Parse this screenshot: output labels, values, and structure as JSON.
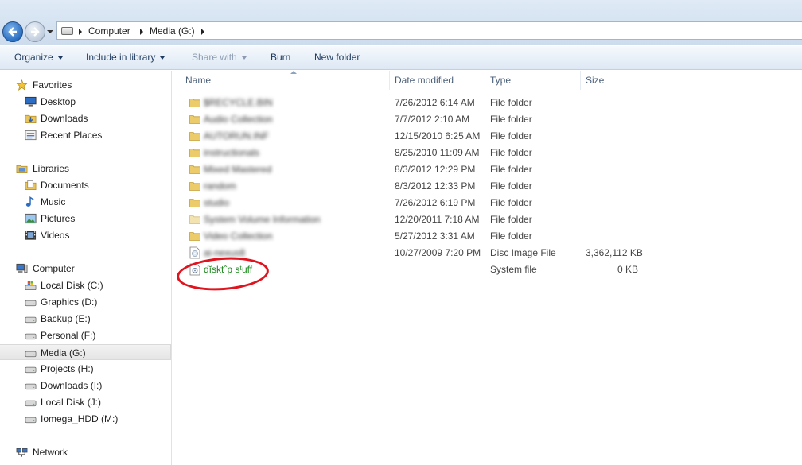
{
  "address": {
    "crumbs": [
      "Computer",
      "Media (G:)"
    ]
  },
  "toolbar": {
    "organize": "Organize",
    "include": "Include in library",
    "share": "Share with",
    "burn": "Burn",
    "newfolder": "New folder"
  },
  "sidebar": {
    "favorites": "Favorites",
    "fav_items": [
      "Desktop",
      "Downloads",
      "Recent Places"
    ],
    "libraries": "Libraries",
    "lib_items": [
      "Documents",
      "Music",
      "Pictures",
      "Videos"
    ],
    "computer": "Computer",
    "drives": [
      "Local Disk (C:)",
      "Graphics (D:)",
      "Backup (E:)",
      "Personal (F:)",
      "Media (G:)",
      "Projects (H:)",
      "Downloads (I:)",
      "Local Disk (J:)",
      "Iomega_HDD (M:)"
    ],
    "network": "Network"
  },
  "columns": {
    "name": "Name",
    "date": "Date modified",
    "type": "Type",
    "size": "Size"
  },
  "files": [
    {
      "name": "$RECYCLE.BIN",
      "date": "7/26/2012 6:14 AM",
      "type": "File folder",
      "size": ""
    },
    {
      "name": "Audio Collection",
      "date": "7/7/2012 2:10 AM",
      "type": "File folder",
      "size": ""
    },
    {
      "name": "AUTORUN.INF",
      "date": "12/15/2010 6:25 AM",
      "type": "File folder",
      "size": ""
    },
    {
      "name": "instructionals",
      "date": "8/25/2010 11:09 AM",
      "type": "File folder",
      "size": ""
    },
    {
      "name": "Mixed Mastered",
      "date": "8/3/2012 12:29 PM",
      "type": "File folder",
      "size": ""
    },
    {
      "name": "random",
      "date": "8/3/2012 12:33 PM",
      "type": "File folder",
      "size": ""
    },
    {
      "name": "studio",
      "date": "7/26/2012 6:19 PM",
      "type": "File folder",
      "size": ""
    },
    {
      "name": "System Volume Information",
      "date": "12/20/2011 7:18 AM",
      "type": "File folder",
      "size": ""
    },
    {
      "name": "Video Collection",
      "date": "5/27/2012 3:31 AM",
      "type": "File folder",
      "size": ""
    },
    {
      "name": "ai-nexus8",
      "date": "10/27/2009 7:20 PM",
      "type": "Disc Image File",
      "size": "3,362,112 KB"
    },
    {
      "name": "dĭsktˆp sᵗuff",
      "date": "",
      "type": "System file",
      "size": "0 KB"
    }
  ]
}
